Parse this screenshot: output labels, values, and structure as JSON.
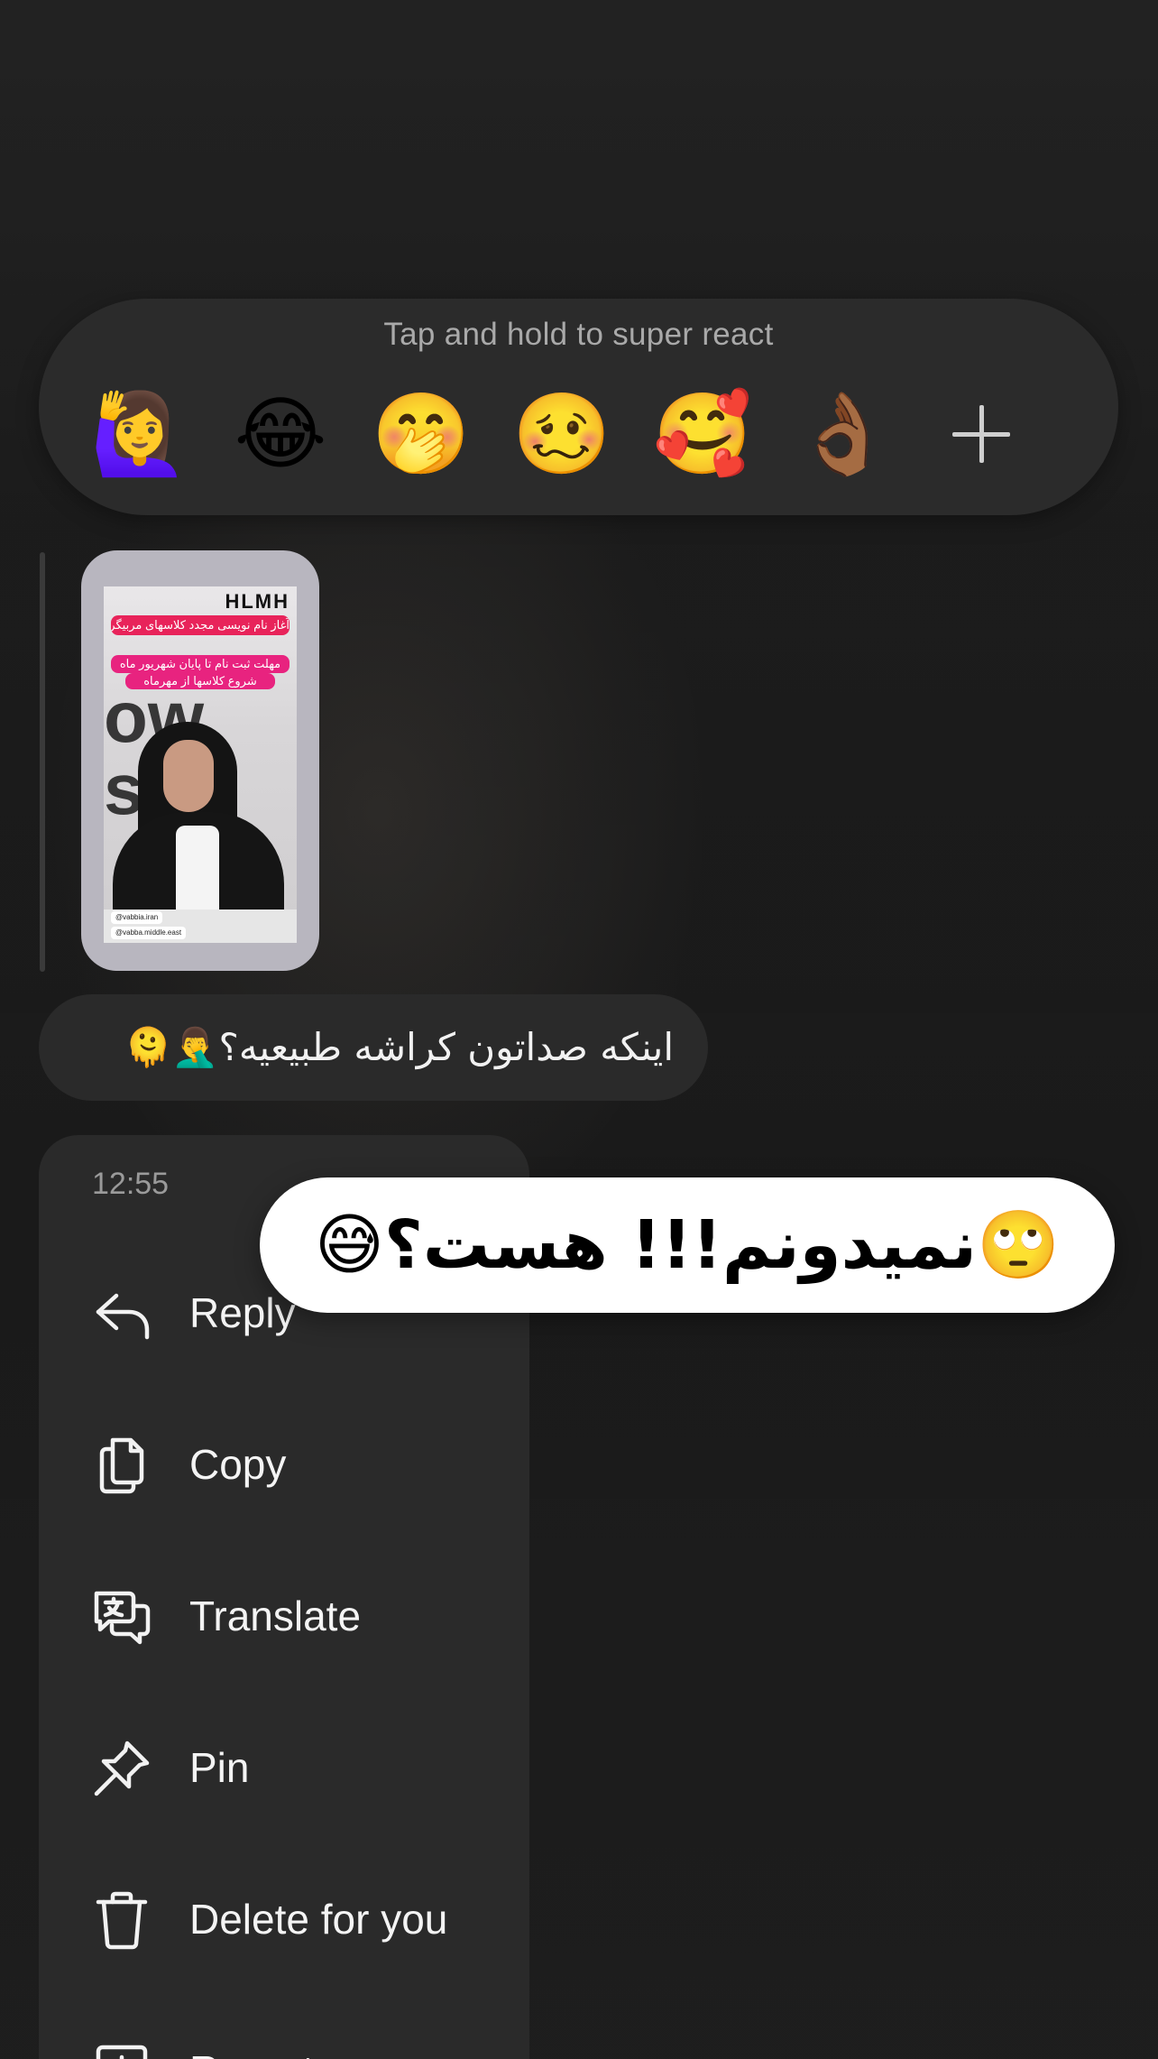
{
  "reaction_bar": {
    "hint": "Tap and hold to super react",
    "emojis": [
      "🙋‍♀️",
      "😂",
      "🤭",
      "🥴",
      "🥰",
      "👌🏾"
    ],
    "more_icon": "plus-icon"
  },
  "story": {
    "logo": "HLMH",
    "banner_1": "آغاز نام نویسی مجدد کلاسهای مربیگری",
    "banner_2": "مهلت ثبت نام تا پایان شهریور ماه",
    "banner_3": "شروع کلاسها از مهرماه",
    "background_text": "ow sw",
    "handle_1": "@vabbia.iran",
    "handle_2": "@vabba.middle.east"
  },
  "received_message": {
    "text": "اینکه صداتون کراشه طبیعیه؟🤦‍♂️🫠"
  },
  "context_menu": {
    "time": "12:55",
    "items": [
      {
        "label": "Reply",
        "icon": "reply-icon"
      },
      {
        "label": "Copy",
        "icon": "copy-icon"
      },
      {
        "label": "Translate",
        "icon": "translate-icon"
      },
      {
        "label": "Pin",
        "icon": "pin-icon"
      },
      {
        "label": "Delete for you",
        "icon": "trash-icon"
      },
      {
        "label": "Report",
        "icon": "report-icon"
      }
    ]
  },
  "sent_message": {
    "text": "🙄نمیدونم!!! هست؟😅"
  },
  "colors": {
    "background": "#1f1f1f",
    "panel": "#2a2a2a",
    "muted_text": "#9a9a9a",
    "primary_text": "#f4f4f4",
    "sent_bubble": "#ffffff"
  }
}
